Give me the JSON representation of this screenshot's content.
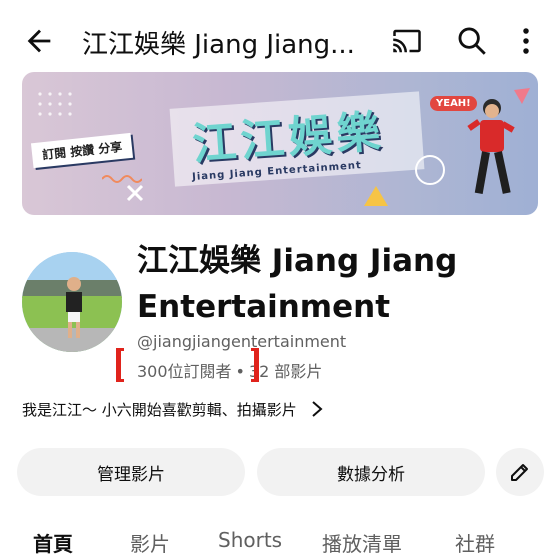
{
  "header": {
    "title": "江江娛樂 Jiang Jiang...",
    "icons": [
      "back-arrow-icon",
      "cast-icon",
      "search-icon",
      "more-vert-icon"
    ]
  },
  "banner": {
    "tag": "訂閱 按讚 分享",
    "title_cn": "江江娛樂",
    "title_en": "Jiang Jiang Entertainment",
    "sticker": "YEAH!"
  },
  "channel": {
    "name": "江江娛樂 Jiang Jiang Entertainment",
    "handle": "@jiangjiangentertainment",
    "subscribers": "300位訂閱者",
    "separator": "•",
    "videos": "32 部影片",
    "description": "我是江江～ 小六開始喜歡剪輯、拍攝影片"
  },
  "actions": {
    "manage_label": "管理影片",
    "analytics_label": "數據分析"
  },
  "tabs": [
    {
      "label": "首頁",
      "active": true
    },
    {
      "label": "影片"
    },
    {
      "label": "Shorts"
    },
    {
      "label": "播放清單"
    },
    {
      "label": "社群"
    }
  ],
  "colors": {
    "annotation_red": "#e0231c",
    "button_bg": "#f2f2f2",
    "secondary_text": "#606060"
  }
}
